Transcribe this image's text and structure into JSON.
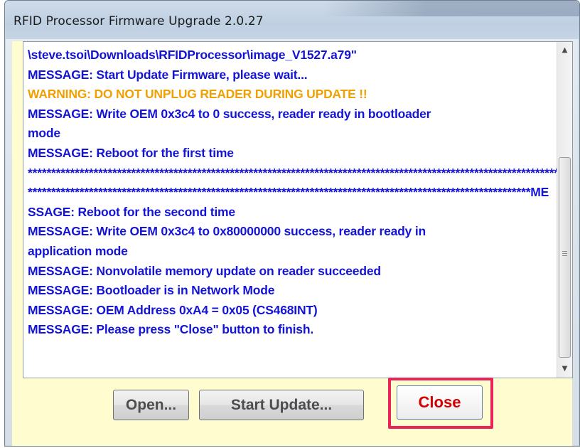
{
  "window": {
    "title": "RFID Processor Firmware Upgrade 2.0.27"
  },
  "log": {
    "lines": [
      {
        "text": "\\steve.tsoi\\Downloads\\RFIDProcessor\\image_V1527.a79\"",
        "type": "message"
      },
      {
        "text": "MESSAGE: Start Update Firmware, please wait...",
        "type": "message"
      },
      {
        "text": "WARNING: DO NOT UNPLUG READER DURING UPDATE !!",
        "type": "warning"
      },
      {
        "text": "MESSAGE: Write OEM 0x3c4 to 0 success, reader ready in bootloader",
        "type": "message"
      },
      {
        "text": "mode",
        "type": "message"
      },
      {
        "text": "MESSAGE: Reboot for the first time",
        "type": "message"
      },
      {
        "text": "*******************************************************************************************************************************",
        "type": "message"
      },
      {
        "text": "***********************************************************************************************************ME",
        "type": "message"
      },
      {
        "text": "SSAGE: Reboot for the second time",
        "type": "message"
      },
      {
        "text": "MESSAGE: Write OEM 0x3c4 to 0x80000000 success, reader ready in",
        "type": "message"
      },
      {
        "text": "application mode",
        "type": "message"
      },
      {
        "text": "MESSAGE: Nonvolatile memory update on reader succeeded",
        "type": "message"
      },
      {
        "text": "MESSAGE: Bootloader is in Network Mode",
        "type": "message"
      },
      {
        "text": "MESSAGE: OEM Address 0xA4 = 0x05 (CS468INT)",
        "type": "message"
      },
      {
        "text": "MESSAGE: Please press \"Close\" button to finish.",
        "type": "message"
      }
    ]
  },
  "buttons": {
    "open_label": "Open...",
    "start_update_label": "Start Update...",
    "close_label": "Close"
  },
  "scrollbar": {
    "up_arrow": "▲",
    "down_arrow": "▼"
  },
  "colors": {
    "message": "#1414d6",
    "warning": "#f0a000",
    "highlight": "#e8245a",
    "client_background": "#fffdd0"
  }
}
